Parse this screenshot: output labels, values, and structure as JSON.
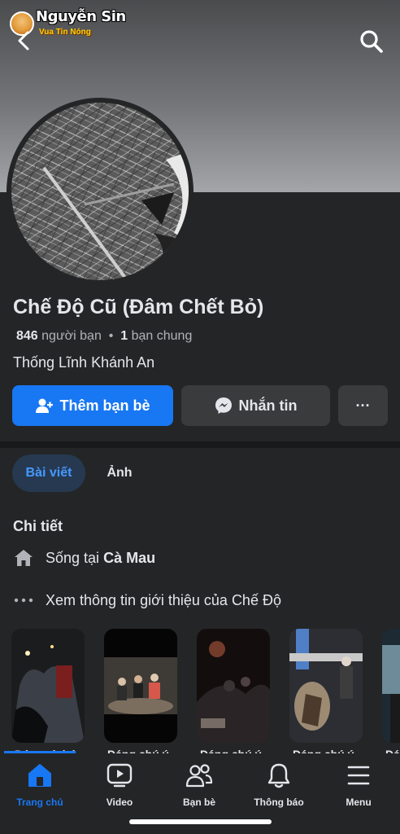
{
  "watermark": {
    "name": "Nguyễn Sin",
    "subtitle": "Vua Tin Nóng"
  },
  "header": {
    "back_icon": "chevron-left-icon",
    "search_icon": "search-icon"
  },
  "profile": {
    "name": "Chế Độ Cũ (Đâm Chết Bỏ)",
    "friend_count": "846",
    "friend_label": "người bạn",
    "separator": "•",
    "mutual_count": "1",
    "mutual_label": "bạn chung",
    "work": "Thống Lĩnh Khánh An"
  },
  "actions": {
    "add_friend": "Thêm bạn bè",
    "message": "Nhắn tin",
    "more": "···"
  },
  "tabs": [
    {
      "label": "Bài viết",
      "active": true
    },
    {
      "label": "Ảnh",
      "active": false
    }
  ],
  "details": {
    "title": "Chi tiết",
    "lives_prefix": "Sống tại",
    "lives_city": "Cà Mau",
    "see_about": "Xem thông tin giới thiệu của Chế Độ"
  },
  "stories": [
    {
      "label": "Đáng chú ý"
    },
    {
      "label": "Đáng chú ý"
    },
    {
      "label": "Đáng chú ý"
    },
    {
      "label": "Đáng chú ý"
    },
    {
      "label": "Đáng chú ý"
    }
  ],
  "nav": [
    {
      "label": "Trang chủ",
      "icon": "home-icon",
      "active": true
    },
    {
      "label": "Video",
      "icon": "video-icon",
      "active": false
    },
    {
      "label": "Bạn bè",
      "icon": "friends-icon",
      "active": false
    },
    {
      "label": "Thông báo",
      "icon": "bell-icon",
      "active": false
    },
    {
      "label": "Menu",
      "icon": "menu-icon",
      "active": false
    }
  ],
  "colors": {
    "accent": "#1877f2",
    "background": "#242526",
    "button": "#3a3b3c"
  }
}
